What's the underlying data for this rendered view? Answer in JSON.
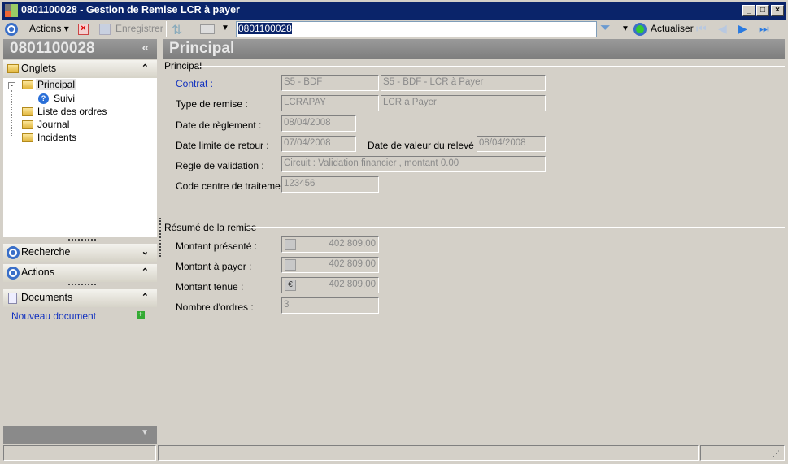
{
  "window": {
    "title": "0801100028 -  Gestion de Remise LCR à payer"
  },
  "toolbar": {
    "actions": "Actions",
    "save": "Enregistrer",
    "search_value": "0801100028",
    "refresh": "Actualiser"
  },
  "sidebar": {
    "header": "0801100028",
    "collapse": "«",
    "panels": {
      "onglets": "Onglets",
      "recherche": "Recherche",
      "actions": "Actions",
      "documents": "Documents"
    },
    "tree": [
      {
        "label": "Principal"
      },
      {
        "label": "Suivi"
      },
      {
        "label": "Liste des ordres"
      },
      {
        "label": "Journal"
      },
      {
        "label": "Incidents"
      }
    ],
    "new_document": "Nouveau document"
  },
  "main": {
    "title": "Principal",
    "group1": "Principal",
    "contrat_label": "Contrat :",
    "contrat_code": "S5 - BDF",
    "contrat_desc": "S5 - BDF - LCR à Payer",
    "type_label": "Type de remise :",
    "type_code": "LCRAPAY",
    "type_desc": "LCR à Payer",
    "date_reglement_label": "Date de règlement :",
    "date_reglement": "08/04/2008",
    "date_limite_label": "Date limite de retour :",
    "date_limite": "07/04/2008",
    "date_valeur_label": "Date de valeur du relevé :",
    "date_valeur": "08/04/2008",
    "regle_label": "Règle de validation :",
    "regle": "Circuit : Validation financier , montant 0.00",
    "code_centre_label": "Code centre de traitement :",
    "code_centre": "123456",
    "group2": "Résumé de la remise",
    "presente_label": "Montant présenté :",
    "presente": "402 809,00",
    "apayer_label": "Montant à payer :",
    "apayer": "402 809,00",
    "tenue_label": "Montant tenue :",
    "tenue": "402 809,00",
    "tenue_currency": "€",
    "nb_ordres_label": "Nombre d'ordres :",
    "nb_ordres": "3"
  }
}
